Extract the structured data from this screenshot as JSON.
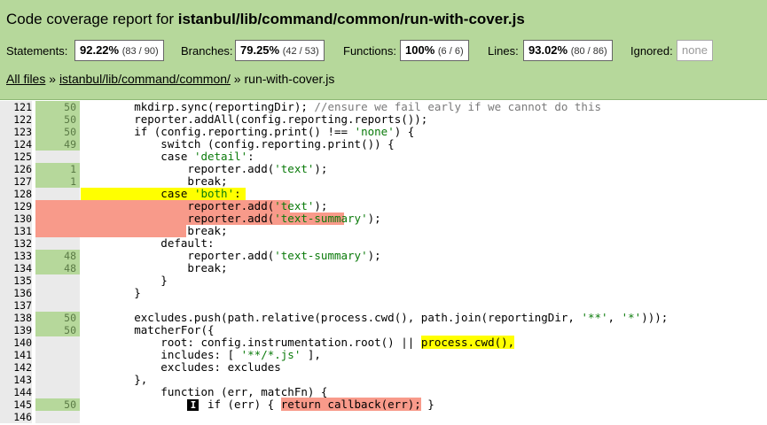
{
  "header": {
    "title_prefix": "Code coverage report for ",
    "title_path": "istanbul/lib/command/common/run-with-cover.js"
  },
  "stats": {
    "statements_label": "Statements:",
    "statements_pct": "92.22%",
    "statements_frac": "(83 / 90)",
    "branches_label": "Branches:",
    "branches_pct": "79.25%",
    "branches_frac": "(42 / 53)",
    "functions_label": "Functions:",
    "functions_pct": "100%",
    "functions_frac": "(6 / 6)",
    "lines_label": "Lines:",
    "lines_pct": "93.02%",
    "lines_frac": "(80 / 86)",
    "ignored_label": "Ignored:",
    "ignored_value": "none"
  },
  "breadcrumb": {
    "all_files": "All files",
    "sep1": " » ",
    "dir": "istanbul/lib/command/common/",
    "sep2": " » ",
    "file": "run-with-cover.js"
  },
  "code_lines": [
    {
      "n": "121",
      "c": "50"
    },
    {
      "n": "122",
      "c": "50"
    },
    {
      "n": "123",
      "c": "50"
    },
    {
      "n": "124",
      "c": "49"
    },
    {
      "n": "125",
      "c": ""
    },
    {
      "n": "126",
      "c": "1"
    },
    {
      "n": "127",
      "c": "1"
    },
    {
      "n": "128",
      "c": ""
    },
    {
      "n": "129",
      "c": ""
    },
    {
      "n": "130",
      "c": ""
    },
    {
      "n": "131",
      "c": ""
    },
    {
      "n": "132",
      "c": ""
    },
    {
      "n": "133",
      "c": "48"
    },
    {
      "n": "134",
      "c": "48"
    },
    {
      "n": "135",
      "c": ""
    },
    {
      "n": "136",
      "c": ""
    },
    {
      "n": "137",
      "c": ""
    },
    {
      "n": "138",
      "c": "50"
    },
    {
      "n": "139",
      "c": "50"
    },
    {
      "n": "140",
      "c": ""
    },
    {
      "n": "141",
      "c": ""
    },
    {
      "n": "142",
      "c": ""
    },
    {
      "n": "143",
      "c": ""
    },
    {
      "n": "144",
      "c": ""
    },
    {
      "n": "145",
      "c": "50"
    },
    {
      "n": "146",
      "c": ""
    }
  ],
  "code": {
    "l121": "        mkdirp.sync(reportingDir); ",
    "l121c": "//ensure we fail early if we cannot do this",
    "l122": "        reporter.addAll(config.reporting.reports());",
    "l123a": "        if (config.reporting.print() !== ",
    "l123s": "'none'",
    "l123b": ") {",
    "l124": "            switch (config.reporting.print()) {",
    "l125a": "            case ",
    "l125s": "'detail'",
    "l125b": ":",
    "l126a": "                reporter.add(",
    "l126s": "'text'",
    "l126b": ");",
    "l127": "                break;",
    "l128a": "            case ",
    "l128s": "'both'",
    "l128b": ":",
    "l129a": "                reporter.add(",
    "l129s": "'text'",
    "l129b": ");",
    "l130a": "                reporter.add(",
    "l130s": "'text-summary'",
    "l130b": ");",
    "l131": "                break;",
    "l132": "            default:",
    "l133a": "                reporter.add(",
    "l133s": "'text-summary'",
    "l133b": ");",
    "l134": "                break;",
    "l135": "            }",
    "l136": "        }",
    "l137": "",
    "l138a": "        excludes.push(path.relative(process.cwd(), path.join(reportingDir, ",
    "l138s1": "'**'",
    "l138m": ", ",
    "l138s2": "'*'",
    "l138b": ")));",
    "l139": "        matcherFor({",
    "l140a": "            root: config.instrumentation.root() || ",
    "l140h": "process.cwd(),",
    "l141a": "            includes: [ ",
    "l141s": "'**/*.js'",
    "l141b": " ],",
    "l142": "            excludes: excludes",
    "l143": "        },",
    "l144": "            function (err, matchFn) {",
    "l145pre": "                ",
    "l145badge": "I",
    "l145a": " if (err) { ",
    "l145h": "return callback(err);",
    "l145b": " }",
    "l146": ""
  }
}
